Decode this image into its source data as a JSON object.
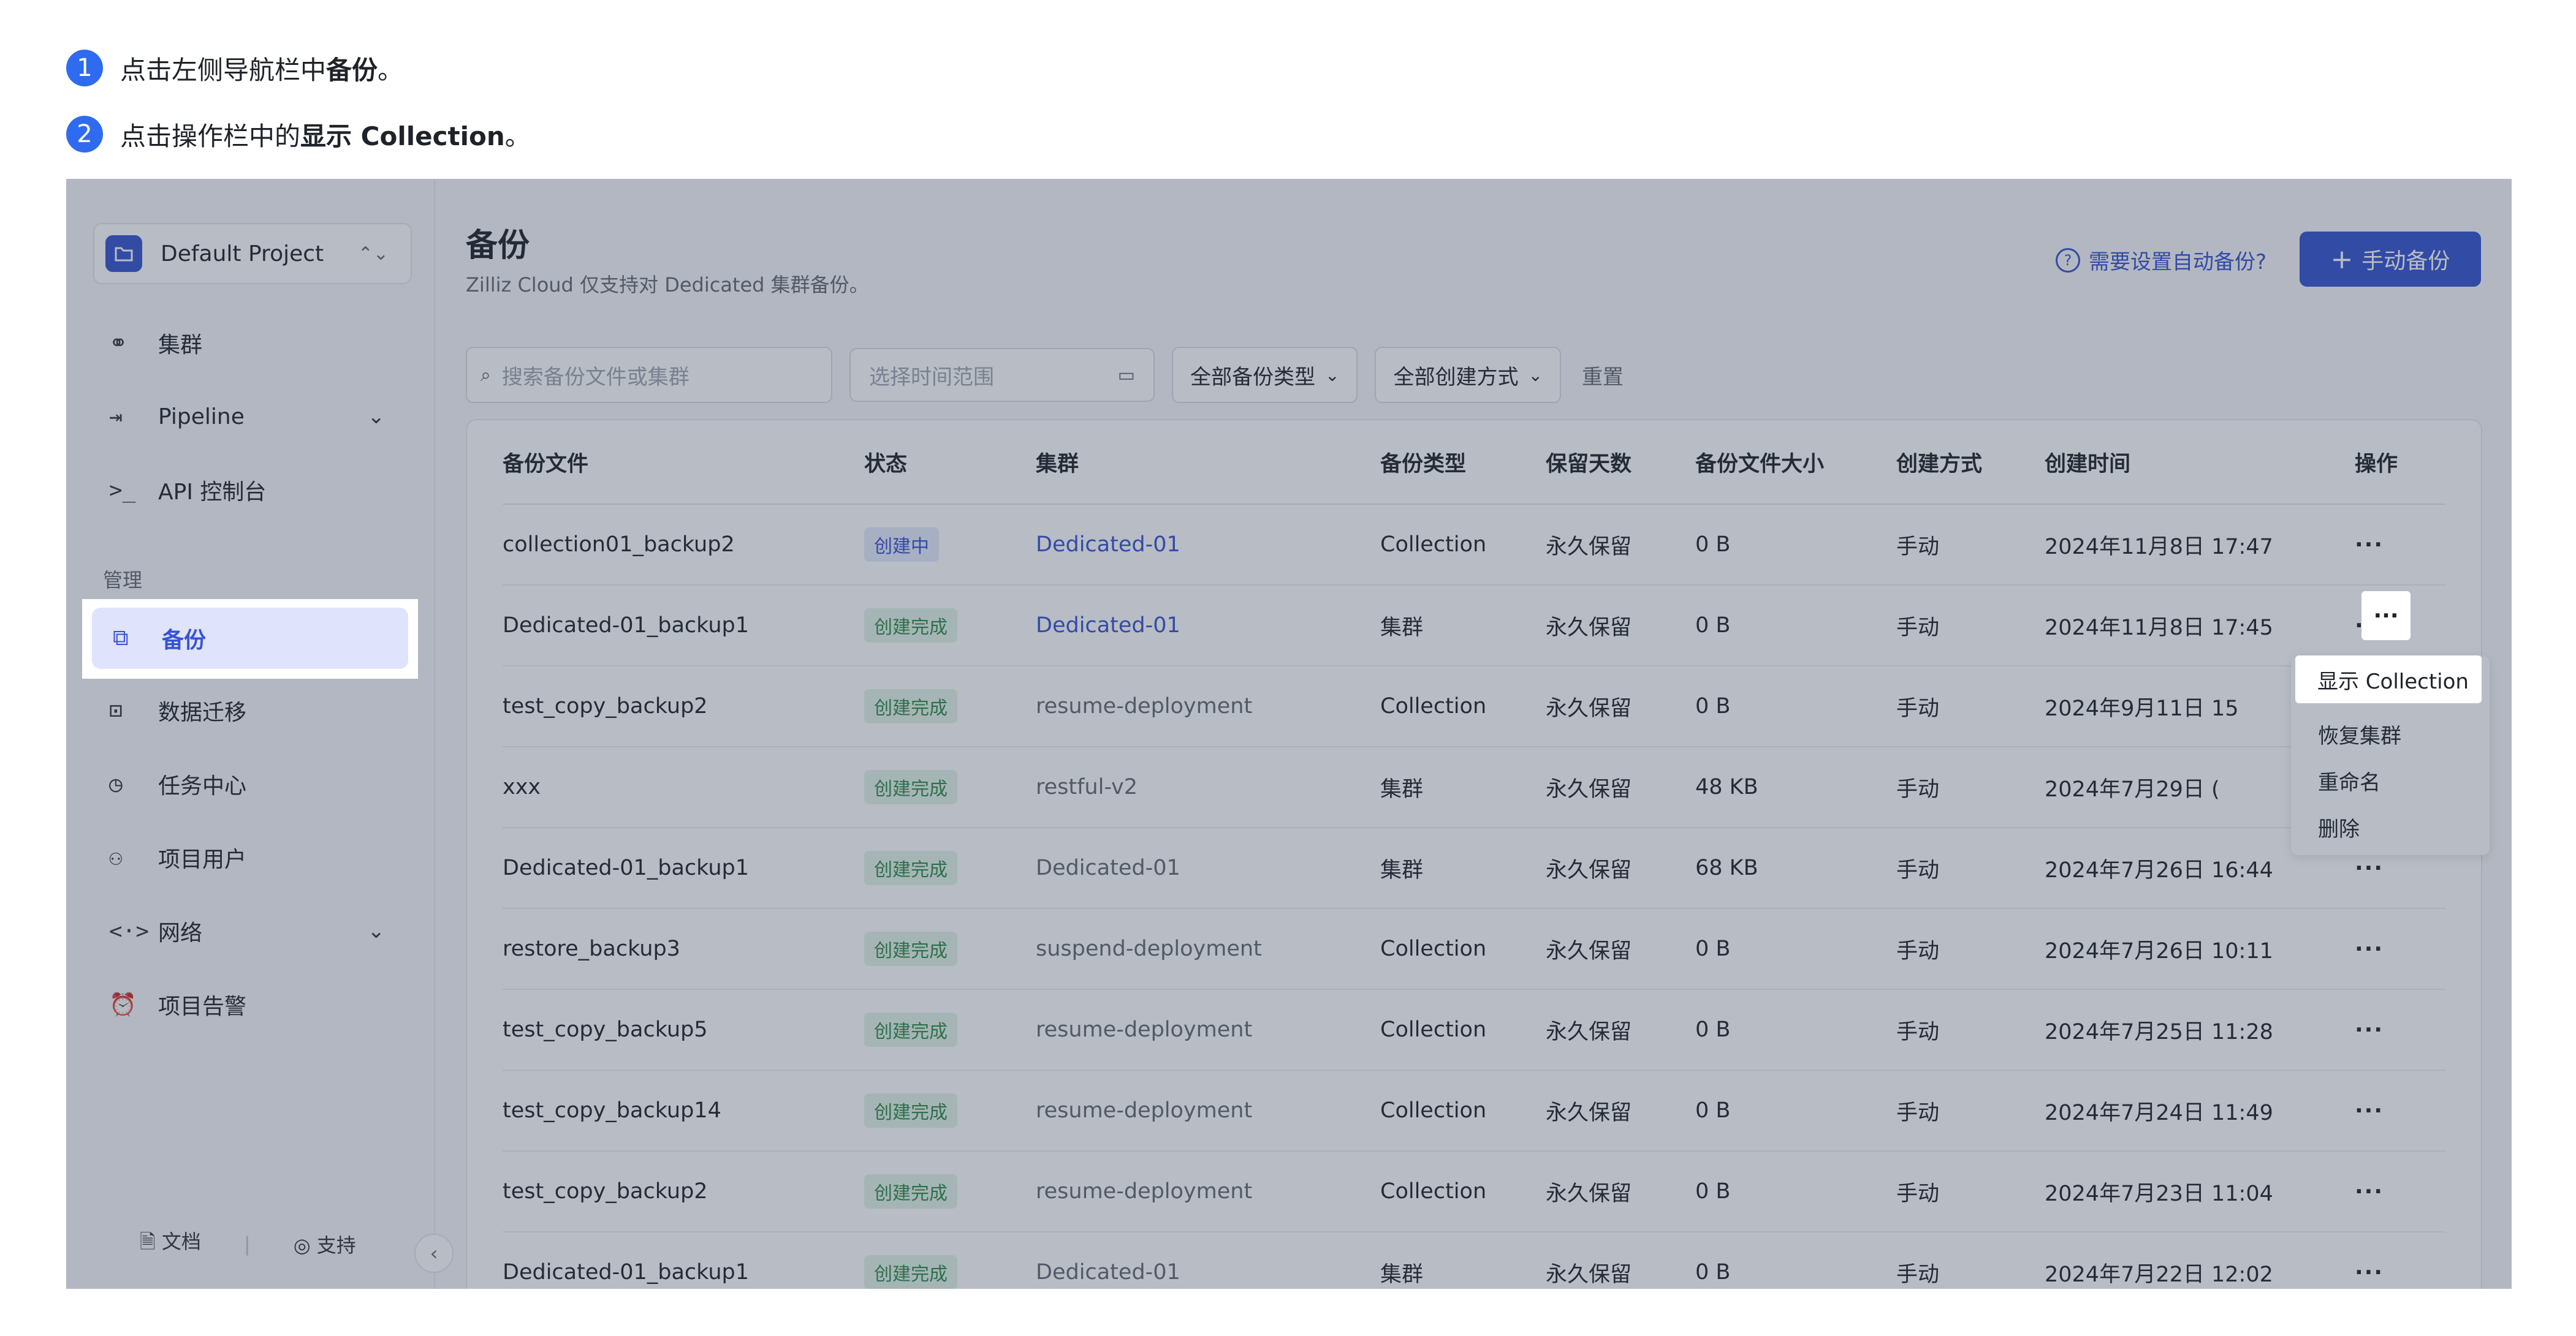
{
  "steps": [
    {
      "num": "1",
      "prefix": "点击左侧导航栏中",
      "bold": "备份",
      "suffix": "。"
    },
    {
      "num": "2",
      "prefix": "点击操作栏中的",
      "bold": "显示 Collection",
      "suffix": "。"
    }
  ],
  "sidebar": {
    "project": "Default Project",
    "items": [
      {
        "label": "集群",
        "icon": "cluster-icon"
      },
      {
        "label": "Pipeline",
        "icon": "pipeline-icon"
      },
      {
        "label": "API 控制台",
        "icon": "terminal-icon"
      }
    ],
    "section_label": "管理",
    "manage_items": [
      {
        "label": "备份",
        "icon": "backup-icon"
      },
      {
        "label": "数据迁移",
        "icon": "migration-icon"
      },
      {
        "label": "任务中心",
        "icon": "history-icon"
      },
      {
        "label": "项目用户",
        "icon": "users-icon"
      },
      {
        "label": "网络",
        "icon": "network-icon"
      },
      {
        "label": "项目告警",
        "icon": "alarm-icon"
      }
    ],
    "footer": {
      "docs": "文档",
      "support": "支持"
    }
  },
  "main": {
    "title": "备份",
    "subtitle": "Zilliz Cloud 仅支持对 Dedicated 集群备份。",
    "auto_link": "需要设置自动备份?",
    "manual_button": "手动备份",
    "search_placeholder": "搜索备份文件或集群",
    "date_placeholder": "选择时间范围",
    "filter_type": "全部备份类型",
    "filter_method": "全部创建方式",
    "reset": "重置"
  },
  "table": {
    "headers": [
      "备份文件",
      "状态",
      "集群",
      "备份类型",
      "保留天数",
      "备份文件大小",
      "创建方式",
      "创建时间",
      "操作"
    ],
    "rows": [
      {
        "file": "collection01_backup2",
        "status": "创建中",
        "cluster": "Dedicated-01",
        "type": "Collection",
        "retain": "永久保留",
        "size": "0 B",
        "method": "手动",
        "time": "2024年11月8日 17:47"
      },
      {
        "file": "Dedicated-01_backup1",
        "status": "创建完成",
        "cluster": "Dedicated-01",
        "type": "集群",
        "retain": "永久保留",
        "size": "0 B",
        "method": "手动",
        "time": "2024年11月8日 17:45"
      },
      {
        "file": "test_copy_backup2",
        "status": "创建完成",
        "cluster": "resume-deployment",
        "type": "Collection",
        "retain": "永久保留",
        "size": "0 B",
        "method": "手动",
        "time": "2024年9月11日 15"
      },
      {
        "file": "xxx",
        "status": "创建完成",
        "cluster": "restful-v2",
        "type": "集群",
        "retain": "永久保留",
        "size": "48 KB",
        "method": "手动",
        "time": "2024年7月29日 ("
      },
      {
        "file": "Dedicated-01_backup1",
        "status": "创建完成",
        "cluster": "Dedicated-01",
        "type": "集群",
        "retain": "永久保留",
        "size": "68 KB",
        "method": "手动",
        "time": "2024年7月26日 16:44"
      },
      {
        "file": "restore_backup3",
        "status": "创建完成",
        "cluster": "suspend-deployment",
        "type": "Collection",
        "retain": "永久保留",
        "size": "0 B",
        "method": "手动",
        "time": "2024年7月26日 10:11"
      },
      {
        "file": "test_copy_backup5",
        "status": "创建完成",
        "cluster": "resume-deployment",
        "type": "Collection",
        "retain": "永久保留",
        "size": "0 B",
        "method": "手动",
        "time": "2024年7月25日 11:28"
      },
      {
        "file": "test_copy_backup14",
        "status": "创建完成",
        "cluster": "resume-deployment",
        "type": "Collection",
        "retain": "永久保留",
        "size": "0 B",
        "method": "手动",
        "time": "2024年7月24日 11:49"
      },
      {
        "file": "test_copy_backup2",
        "status": "创建完成",
        "cluster": "resume-deployment",
        "type": "Collection",
        "retain": "永久保留",
        "size": "0 B",
        "method": "手动",
        "time": "2024年7月23日 11:04"
      },
      {
        "file": "Dedicated-01_backup1",
        "status": "创建完成",
        "cluster": "Dedicated-01",
        "type": "集群",
        "retain": "永久保留",
        "size": "0 B",
        "method": "手动",
        "time": "2024年7月22日 12:02"
      }
    ],
    "more": "···"
  },
  "menu": [
    "显示 Collection",
    "恢复集群",
    "重命名",
    "删除"
  ]
}
